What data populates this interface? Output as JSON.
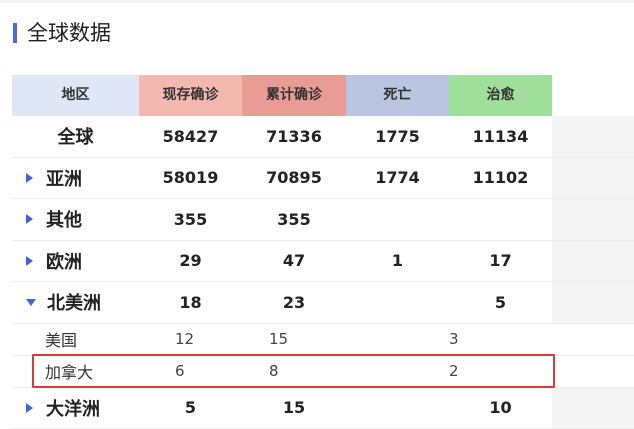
{
  "page": {
    "title": "全球数据"
  },
  "table": {
    "headers": {
      "region": "地区",
      "current": "现存确诊",
      "total": "累计确诊",
      "death": "死亡",
      "cured": "治愈"
    },
    "header_colors": {
      "region": "#dfe6f5",
      "current": "#f3b8ae",
      "total": "#e89c93",
      "death": "#b9c5e1",
      "cured": "#9ee09a"
    },
    "rows": [
      {
        "name": "全球",
        "current": "58427",
        "total": "71336",
        "death": "1775",
        "cured": "11134",
        "arrow": "none"
      },
      {
        "name": "亚洲",
        "current": "58019",
        "total": "70895",
        "death": "1774",
        "cured": "11102",
        "arrow": "right"
      },
      {
        "name": "其他",
        "current": "355",
        "total": "355",
        "death": "",
        "cured": "",
        "arrow": "right"
      },
      {
        "name": "欧洲",
        "current": "29",
        "total": "47",
        "death": "1",
        "cured": "17",
        "arrow": "right"
      },
      {
        "name": "北美洲",
        "current": "18",
        "total": "23",
        "death": "",
        "cured": "5",
        "arrow": "down"
      }
    ],
    "subrows": [
      {
        "name": "美国",
        "current": "12",
        "total": "15",
        "death": "",
        "cured": "3"
      },
      {
        "name": "加拿大",
        "current": "6",
        "total": "8",
        "death": "",
        "cured": "2"
      }
    ],
    "last_row": {
      "name": "大洋洲",
      "current": "5",
      "total": "15",
      "death": "",
      "cured": "10",
      "arrow": "right"
    }
  },
  "colors": {
    "accent": "#4a6bdc",
    "arrow": "#3f66d8",
    "highlight_border": "#d93b3b"
  }
}
